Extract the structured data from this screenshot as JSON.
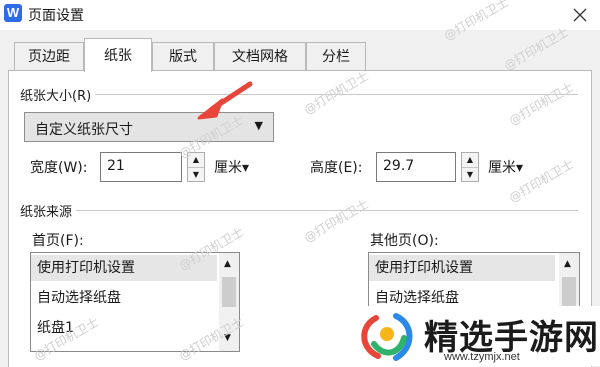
{
  "window": {
    "app_icon": "W",
    "title": "页面设置",
    "close_icon": "close-icon"
  },
  "tabs": [
    {
      "label": "页边距",
      "active": false
    },
    {
      "label": "纸张",
      "active": true
    },
    {
      "label": "版式",
      "active": false
    },
    {
      "label": "文档网格",
      "active": false
    },
    {
      "label": "分栏",
      "active": false
    }
  ],
  "paper_size": {
    "group_label": "纸张大小(R)",
    "selected": "自定义纸张尺寸",
    "width_label": "宽度(W):",
    "width_value": "21",
    "width_unit": "厘米▾",
    "height_label": "高度(E):",
    "height_value": "29.7",
    "height_unit": "厘米▾"
  },
  "paper_source": {
    "group_label": "纸张来源",
    "first_page": {
      "label": "首页(F):",
      "items": [
        "使用打印机设置",
        "自动选择纸盘",
        "纸盘1"
      ]
    },
    "other_pages": {
      "label": "其他页(O):",
      "items": [
        "使用打印机设置",
        "自动选择纸盘"
      ]
    }
  },
  "watermark_text": "@打印机卫士",
  "brand": {
    "name": "精选手游网",
    "url": "www.tzymjx.net"
  },
  "annotation": {
    "color": "#e8463b",
    "type": "red arrow pointing at paper size dropdown"
  }
}
